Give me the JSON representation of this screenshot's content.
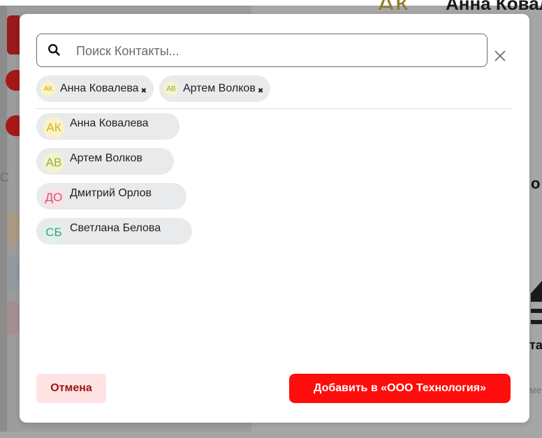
{
  "background": {
    "avatar_initials": "АК",
    "contact_name": "Анна Ковалева",
    "left_letter": "С",
    "right_text_1": "о",
    "right_text_2": "та",
    "right_text_3": "ме"
  },
  "modal": {
    "search": {
      "placeholder": "Поиск Контакты...",
      "value": ""
    },
    "selected": [
      {
        "initials": "АК",
        "name": "Анна Ковалева",
        "remove": "✖",
        "avatar_bg": "#fbf3c6",
        "avatar_color": "#c4a818"
      },
      {
        "initials": "АВ",
        "name": "Артем Волков",
        "remove": "✖",
        "avatar_bg": "#f2f3cf",
        "avatar_color": "#9aa53c"
      }
    ],
    "contacts": [
      {
        "initials": "АК",
        "name": "Анна Ковалева",
        "avatar_bg": "#fbf3c6",
        "avatar_color": "#d2b21a"
      },
      {
        "initials": "АВ",
        "name": "Артем Волков",
        "avatar_bg": "#f2f3cf",
        "avatar_color": "#a0ab3c"
      },
      {
        "initials": "ДО",
        "name": "Дмитрий Орлов",
        "avatar_bg": "#fbe2e6",
        "avatar_color": "#c8586c"
      },
      {
        "initials": "СБ",
        "name": "Светлана Белова",
        "avatar_bg": "#dff1ea",
        "avatar_color": "#4b9c7e"
      }
    ],
    "cancel_label": "Отмена",
    "add_label": "Добавить в «ООО Технология»"
  },
  "colors": {
    "accent": "#ff0d0d",
    "cancel_bg": "#fde3e3",
    "cancel_text": "#9c1414",
    "chip_bg": "#e9eaeb"
  }
}
